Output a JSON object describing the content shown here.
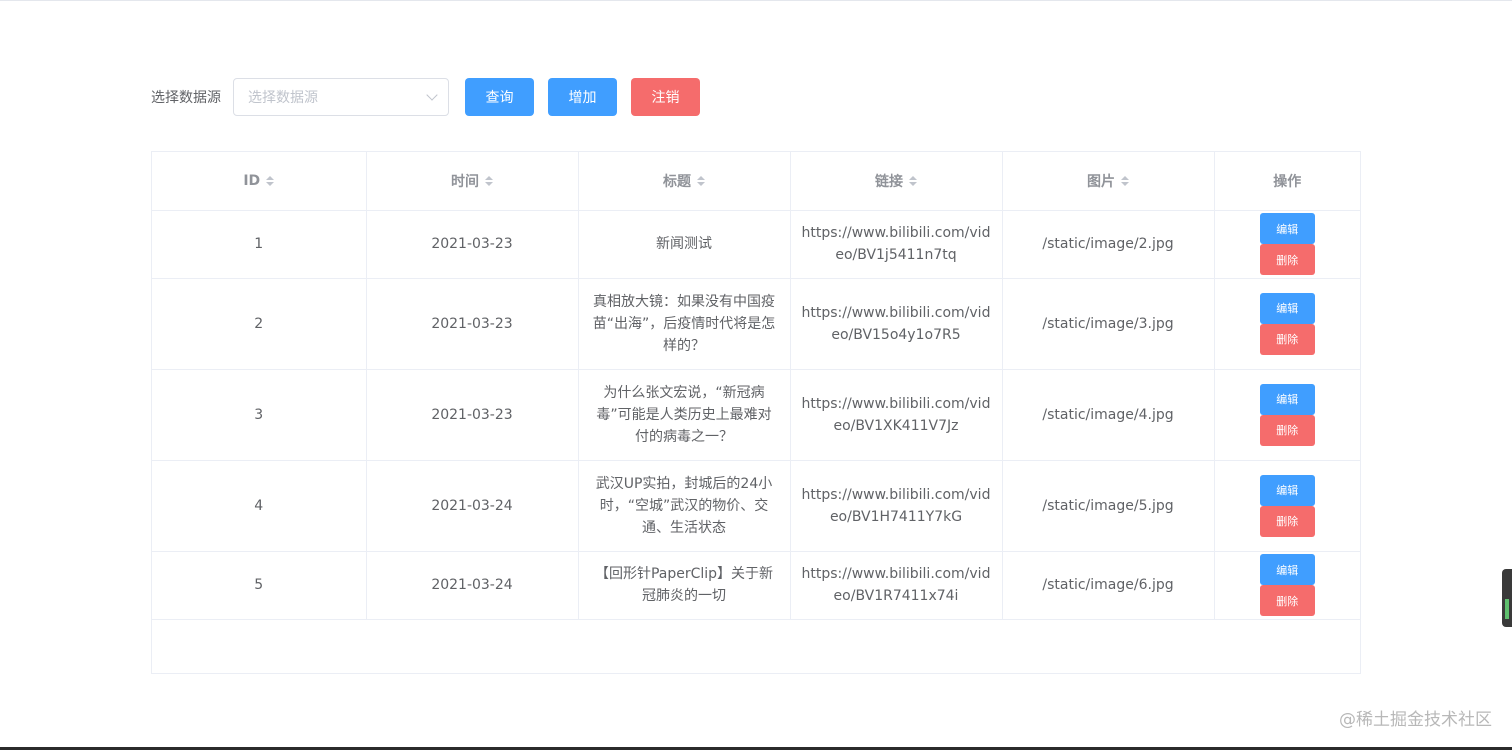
{
  "toolbar": {
    "label": "选择数据源",
    "select_placeholder": "选择数据源",
    "query_label": "查询",
    "add_label": "增加",
    "logout_label": "注销"
  },
  "table": {
    "headers": {
      "id": "ID",
      "time": "时间",
      "title": "标题",
      "link": "链接",
      "image": "图片",
      "action": "操作"
    },
    "edit_label": "编辑",
    "delete_label": "删除",
    "rows": [
      {
        "id": "1",
        "time": "2021-03-23",
        "title": "新闻测试",
        "link": "https://www.bilibili.com/video/BV1j5411n7tq",
        "image": "/static/image/2.jpg"
      },
      {
        "id": "2",
        "time": "2021-03-23",
        "title": "真相放大镜：如果没有中国疫苗“出海”，后疫情时代将是怎样的？",
        "link": "https://www.bilibili.com/video/BV15o4y1o7R5",
        "image": "/static/image/3.jpg"
      },
      {
        "id": "3",
        "time": "2021-03-23",
        "title": "为什么张文宏说，“新冠病毒”可能是人类历史上最难对付的病毒之一？",
        "link": "https://www.bilibili.com/video/BV1XK411V7Jz",
        "image": "/static/image/4.jpg"
      },
      {
        "id": "4",
        "time": "2021-03-24",
        "title": "武汉UP实拍，封城后的24小时，“空城”武汉的物价、交通、生活状态",
        "link": "https://www.bilibili.com/video/BV1H7411Y7kG",
        "image": "/static/image/5.jpg"
      },
      {
        "id": "5",
        "time": "2021-03-24",
        "title": "【回形针PaperClip】关于新冠肺炎的一切",
        "link": "https://www.bilibili.com/video/BV1R7411x74i",
        "image": "/static/image/6.jpg"
      }
    ]
  },
  "watermark": "@稀土掘金技术社区",
  "colors": {
    "primary": "#409eff",
    "danger": "#f56c6c",
    "border": "#ebeef5",
    "text": "#606266",
    "header_text": "#909399"
  }
}
